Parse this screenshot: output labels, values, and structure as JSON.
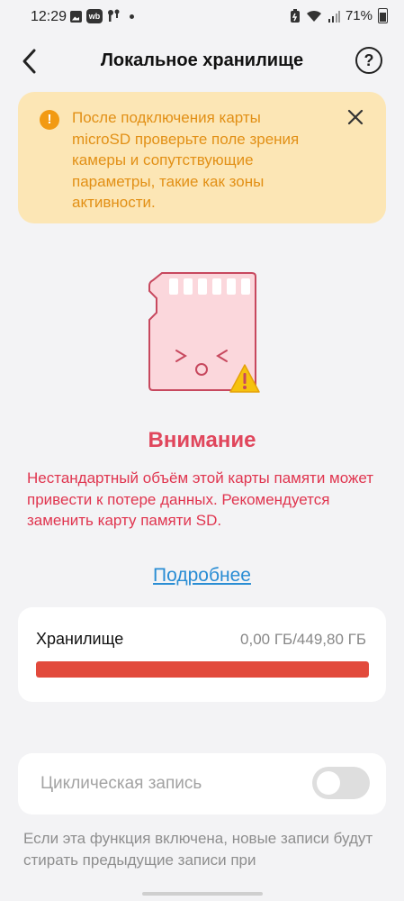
{
  "status_bar": {
    "time": "12:29",
    "wb_badge": "wb",
    "battery_percent": "71%"
  },
  "header": {
    "title": "Локальное хранилище",
    "back_icon": "chevron-left-icon",
    "help_icon": "question-circle-icon",
    "help_glyph": "?"
  },
  "banner": {
    "icon_glyph": "!",
    "text": "После подключения карты microSD проверьте поле зрения камеры и сопутствующие параметры, такие как зоны активности.",
    "close_icon": "close-icon",
    "bg_color": "#fce6b5",
    "text_color": "#e29016"
  },
  "attention": {
    "title": "Внимание",
    "text": "Нестандартный объём этой карты памяти может привести к потере данных. Рекомендуется заменить карту памяти SD.",
    "link": "Подробнее",
    "color": "#e0465c"
  },
  "storage": {
    "label": "Хранилище",
    "value": "0,00 ГБ/449,80 ГБ",
    "fill_fraction": 1.0,
    "bar_color": "#e24a3c"
  },
  "loop_recording": {
    "label": "Циклическая запись",
    "enabled": false,
    "description": "Если эта функция включена, новые записи будут стирать предыдущие записи при"
  }
}
